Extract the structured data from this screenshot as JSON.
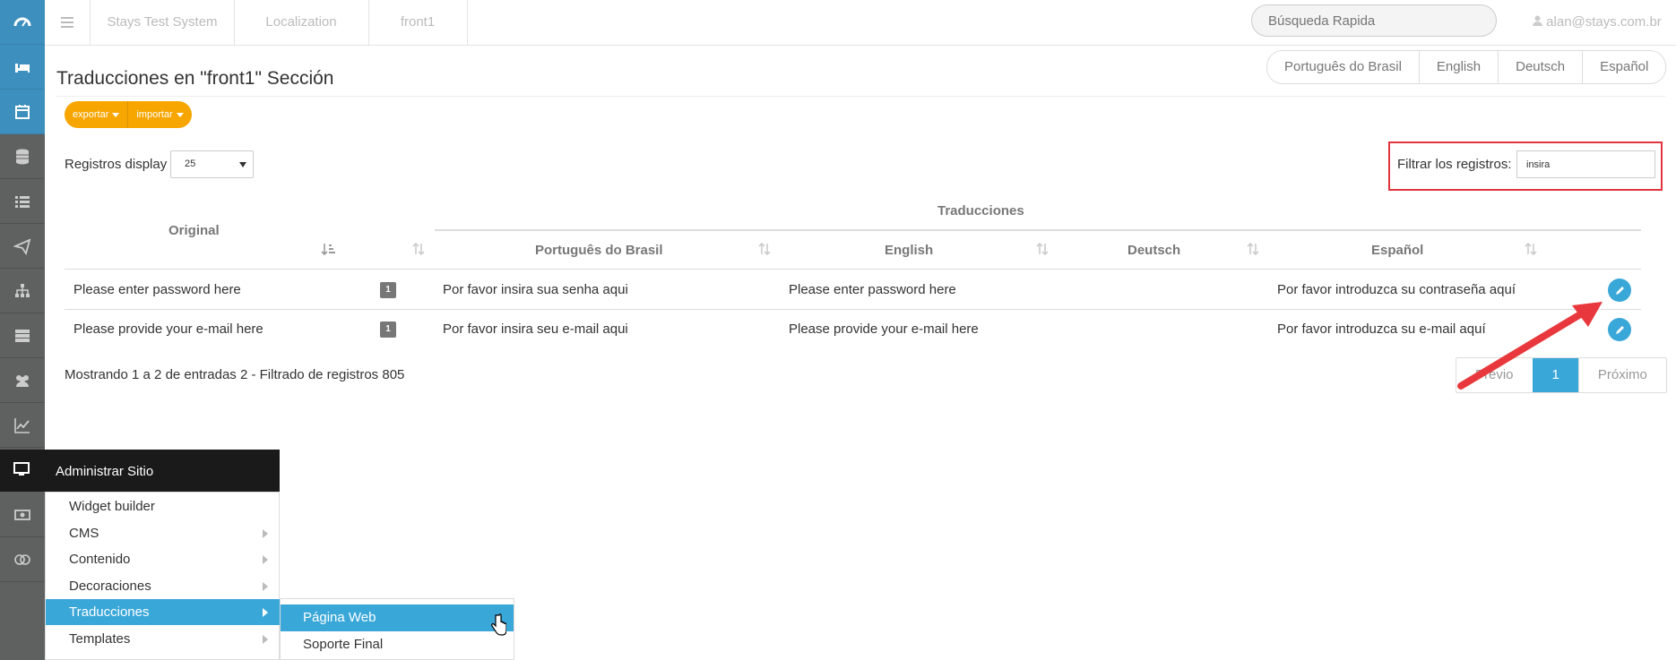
{
  "topbar": {
    "crumbs": [
      "Stays Test System",
      "Localization",
      "front1"
    ],
    "search_placeholder": "Búsqueda Rapida",
    "user": "alan@stays.com.br"
  },
  "page": {
    "title": "Traducciones en \"front1\" Sección",
    "language_tabs": [
      "Português do Brasil",
      "English",
      "Deutsch",
      "Español"
    ],
    "buttons": {
      "export": "exportar",
      "import": "importar"
    },
    "length_label": "Registros display",
    "length_value": "25",
    "filter_label": "Filtrar los registros:",
    "filter_value": "insira"
  },
  "table": {
    "group_header": "Traducciones",
    "columns": [
      "Original",
      "Português do Brasil",
      "English",
      "Deutsch",
      "Español"
    ],
    "rows": [
      {
        "original": "Please enter password here",
        "badge": "1",
        "pt": "Por favor insira sua senha aqui",
        "en": "Please enter password here",
        "de": "",
        "es": "Por favor introduzca su contraseña aquí"
      },
      {
        "original": "Please provide your e-mail here",
        "badge": "1",
        "pt": "Por favor insira seu e-mail aqui",
        "en": "Please provide your e-mail here",
        "de": "",
        "es": "Por favor introduzca su e-mail aquí"
      }
    ],
    "info": "Mostrando 1 a 2 de entradas 2 - Filtrado de registros 805",
    "pager": {
      "prev": "Previo",
      "current": "1",
      "next": "Próximo"
    }
  },
  "menu": {
    "header": "Administrar Sitio",
    "items": [
      "Widget builder",
      "CMS",
      "Contenido",
      "Decoraciones",
      "Traducciones",
      "Templates"
    ],
    "active_item": "Traducciones",
    "submenu": [
      "Página Web",
      "Soporte Final"
    ],
    "active_subitem": "Página Web"
  },
  "colors": {
    "accent": "#3aa7d9",
    "orange": "#f7a600",
    "highlight_red": "#e0353f",
    "sidebar": "#5f6060"
  },
  "icons": [
    "dashboard-icon",
    "bed-icon",
    "calendar-icon",
    "database-icon",
    "list-icon",
    "paper-plane-icon",
    "sitemap-icon",
    "server-icon",
    "users-icon",
    "chart-icon",
    "monitor-icon",
    "money-icon",
    "rings-icon"
  ]
}
